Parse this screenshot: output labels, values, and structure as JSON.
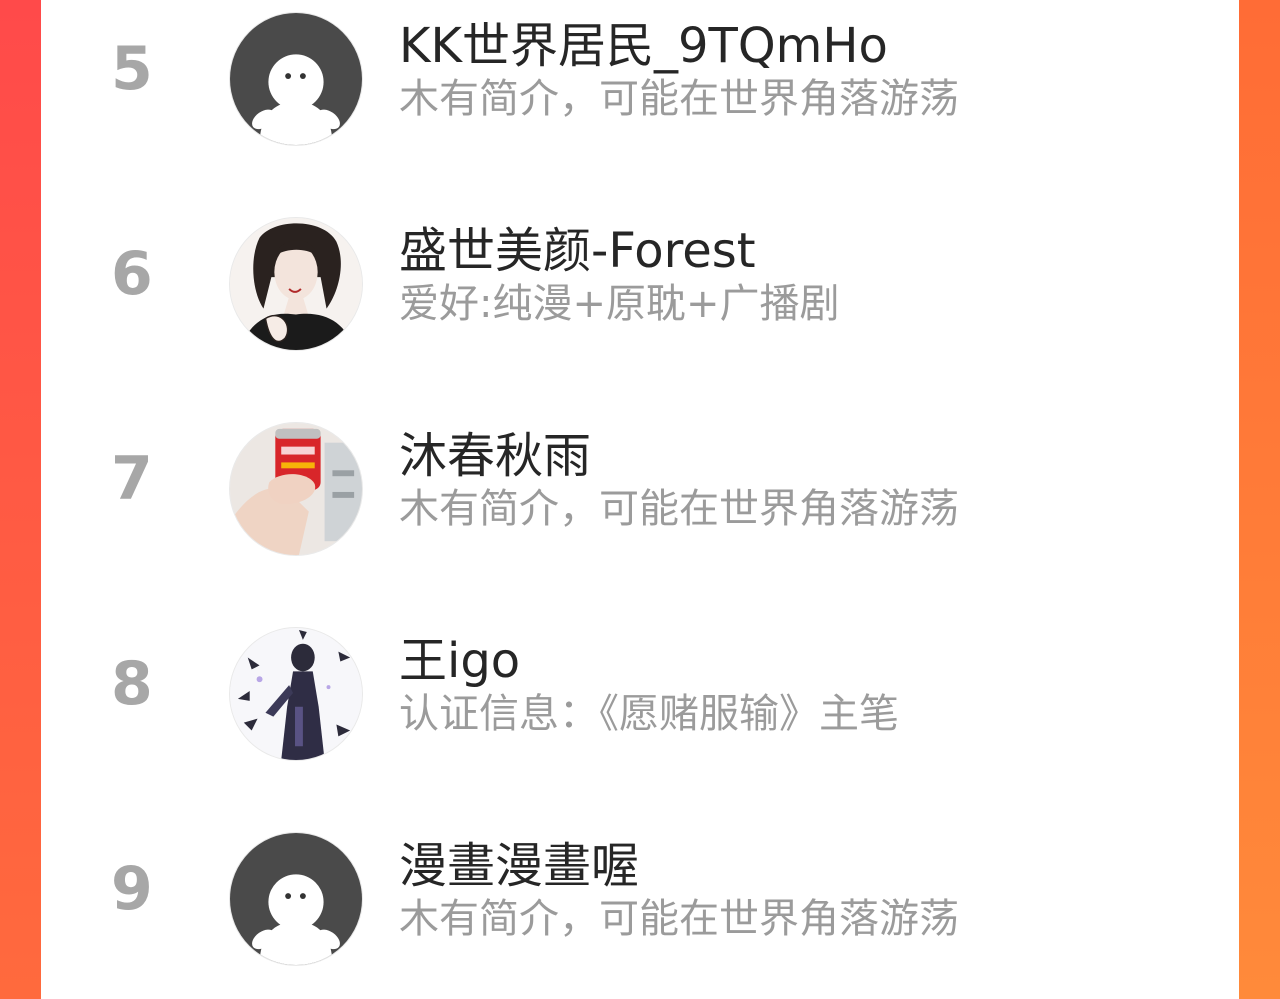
{
  "ranking": {
    "items": [
      {
        "rank": "5",
        "name": "KK世界居民_9TQmHo",
        "desc": "木有简介，可能在世界角落游荡",
        "avatar": "default-avatar"
      },
      {
        "rank": "6",
        "name": "盛世美颜-Forest",
        "desc": "爱好:纯漫+原耽+广播剧",
        "avatar": "illustrated-portrait"
      },
      {
        "rank": "7",
        "name": "沐春秋雨",
        "desc": "木有简介，可能在世界角落游荡",
        "avatar": "photo-avatar"
      },
      {
        "rank": "8",
        "name": "王igo",
        "desc": "认证信息：《愿赌服输》主笔",
        "avatar": "illustrated-silhouette"
      },
      {
        "rank": "9",
        "name": "漫畫漫畫喔",
        "desc": "木有简介，可能在世界角落游荡",
        "avatar": "default-avatar"
      }
    ]
  },
  "colors": {
    "background_left": "#ff4a4a",
    "background_right": "#ff7c36",
    "rank": "#a7a7a7",
    "name": "#262626",
    "desc": "#9b9b9b",
    "default_avatar": "#4a4a4a"
  }
}
